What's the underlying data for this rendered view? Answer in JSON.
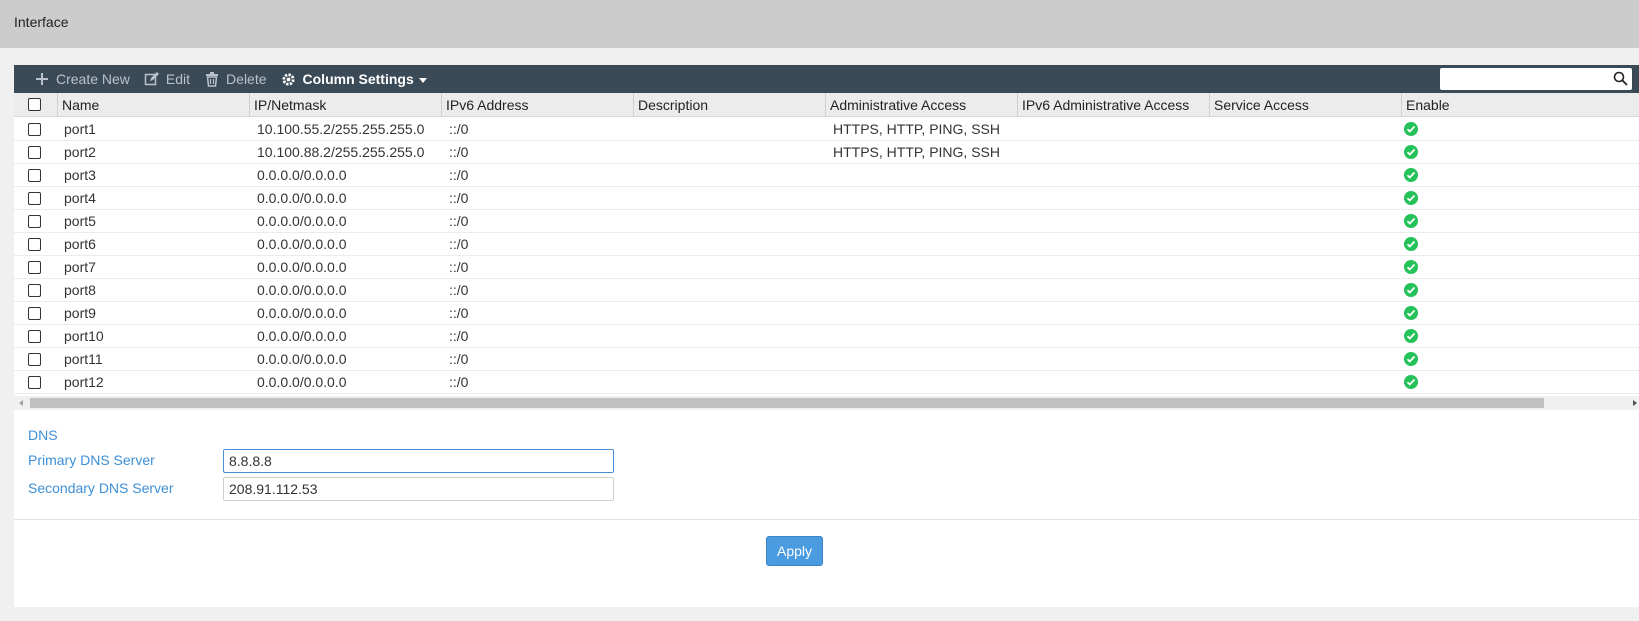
{
  "page": {
    "title": "Interface"
  },
  "toolbar": {
    "create_new": "Create New",
    "edit": "Edit",
    "delete": "Delete",
    "column_settings": "Column Settings",
    "search_placeholder": ""
  },
  "columns": [
    "Name",
    "IP/Netmask",
    "IPv6 Address",
    "Description",
    "Administrative Access",
    "IPv6 Administrative Access",
    "Service Access",
    "Enable"
  ],
  "rows": [
    {
      "name": "port1",
      "ip": "10.100.55.2/255.255.255.0",
      "ipv6": "::/0",
      "description": "",
      "admin_access": "HTTPS, HTTP, PING, SSH",
      "ipv6_admin_access": "",
      "service_access": "",
      "enabled": true
    },
    {
      "name": "port2",
      "ip": "10.100.88.2/255.255.255.0",
      "ipv6": "::/0",
      "description": "",
      "admin_access": "HTTPS, HTTP, PING, SSH",
      "ipv6_admin_access": "",
      "service_access": "",
      "enabled": true
    },
    {
      "name": "port3",
      "ip": "0.0.0.0/0.0.0.0",
      "ipv6": "::/0",
      "description": "",
      "admin_access": "",
      "ipv6_admin_access": "",
      "service_access": "",
      "enabled": true
    },
    {
      "name": "port4",
      "ip": "0.0.0.0/0.0.0.0",
      "ipv6": "::/0",
      "description": "",
      "admin_access": "",
      "ipv6_admin_access": "",
      "service_access": "",
      "enabled": true
    },
    {
      "name": "port5",
      "ip": "0.0.0.0/0.0.0.0",
      "ipv6": "::/0",
      "description": "",
      "admin_access": "",
      "ipv6_admin_access": "",
      "service_access": "",
      "enabled": true
    },
    {
      "name": "port6",
      "ip": "0.0.0.0/0.0.0.0",
      "ipv6": "::/0",
      "description": "",
      "admin_access": "",
      "ipv6_admin_access": "",
      "service_access": "",
      "enabled": true
    },
    {
      "name": "port7",
      "ip": "0.0.0.0/0.0.0.0",
      "ipv6": "::/0",
      "description": "",
      "admin_access": "",
      "ipv6_admin_access": "",
      "service_access": "",
      "enabled": true
    },
    {
      "name": "port8",
      "ip": "0.0.0.0/0.0.0.0",
      "ipv6": "::/0",
      "description": "",
      "admin_access": "",
      "ipv6_admin_access": "",
      "service_access": "",
      "enabled": true
    },
    {
      "name": "port9",
      "ip": "0.0.0.0/0.0.0.0",
      "ipv6": "::/0",
      "description": "",
      "admin_access": "",
      "ipv6_admin_access": "",
      "service_access": "",
      "enabled": true
    },
    {
      "name": "port10",
      "ip": "0.0.0.0/0.0.0.0",
      "ipv6": "::/0",
      "description": "",
      "admin_access": "",
      "ipv6_admin_access": "",
      "service_access": "",
      "enabled": true
    },
    {
      "name": "port11",
      "ip": "0.0.0.0/0.0.0.0",
      "ipv6": "::/0",
      "description": "",
      "admin_access": "",
      "ipv6_admin_access": "",
      "service_access": "",
      "enabled": true
    },
    {
      "name": "port12",
      "ip": "0.0.0.0/0.0.0.0",
      "ipv6": "::/0",
      "description": "",
      "admin_access": "",
      "ipv6_admin_access": "",
      "service_access": "",
      "enabled": true
    }
  ],
  "dns": {
    "title": "DNS",
    "primary_label": "Primary DNS Server",
    "primary_value": "8.8.8.8",
    "secondary_label": "Secondary DNS Server",
    "secondary_value": "208.91.112.53"
  },
  "apply_label": "Apply",
  "icons": {
    "create": "plus-icon",
    "edit": "edit-icon",
    "delete": "trash-icon",
    "column_settings": "gear-icon",
    "search": "search-icon",
    "enabled": "check-circle-icon"
  },
  "colors": {
    "toolbar_bg": "#3b4a57",
    "accent": "#4a9be0",
    "enabled": "#25c25a",
    "label": "#3d8fd6"
  }
}
